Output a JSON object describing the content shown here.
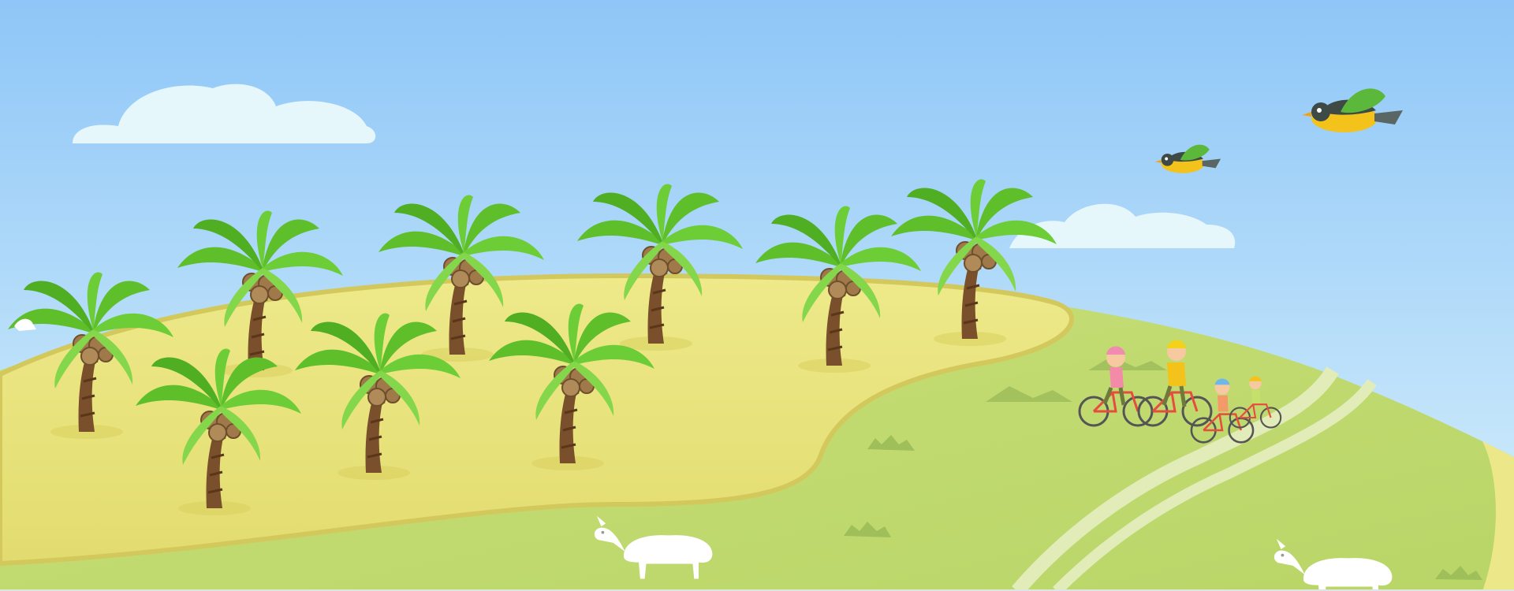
{
  "scene": {
    "description_tag": "cartoon-landscape",
    "colors": {
      "sky_top": "#8ec6f7",
      "sky_bottom": "#d7f0fb",
      "cloud": "#e6f7fb",
      "hill": "#c6de73",
      "hill_light": "#d5e88a",
      "sand": "#e8e37a",
      "sand_edge": "#d3c85c",
      "palm_leaf": "#5fbf2a",
      "palm_leaf_light": "#84d64b",
      "palm_trunk": "#7a4f2b",
      "coconut": "#a0794a",
      "path": "#e2ecb8",
      "bird_body": "#f3c21b",
      "bird_wing": "#5cb83a",
      "bird_head": "#3d4a45",
      "goat": "#ffffff"
    },
    "palm_trees": [
      {
        "id": "palm-1"
      },
      {
        "id": "palm-2"
      },
      {
        "id": "palm-3"
      },
      {
        "id": "palm-4"
      },
      {
        "id": "palm-5"
      },
      {
        "id": "palm-6"
      },
      {
        "id": "palm-7"
      },
      {
        "id": "palm-8"
      },
      {
        "id": "palm-9"
      },
      {
        "id": "palm-10"
      }
    ],
    "cyclists": [
      {
        "id": "cyclist-girl",
        "helmet": "#f08cb0",
        "shirt": "#f28aa8"
      },
      {
        "id": "cyclist-dad",
        "helmet": "#f3d21b",
        "shirt": "#f3c21b"
      },
      {
        "id": "cyclist-kid",
        "helmet": "#6fb7e8",
        "shirt": "#f49a6a"
      },
      {
        "id": "cyclist-small",
        "helmet": "#f3c21b",
        "shirt": "#c6e06a"
      }
    ],
    "birds": [
      {
        "id": "bird-large"
      },
      {
        "id": "bird-small"
      }
    ],
    "goats": [
      {
        "id": "goat-center"
      },
      {
        "id": "goat-right"
      },
      {
        "id": "goat-left"
      }
    ]
  }
}
